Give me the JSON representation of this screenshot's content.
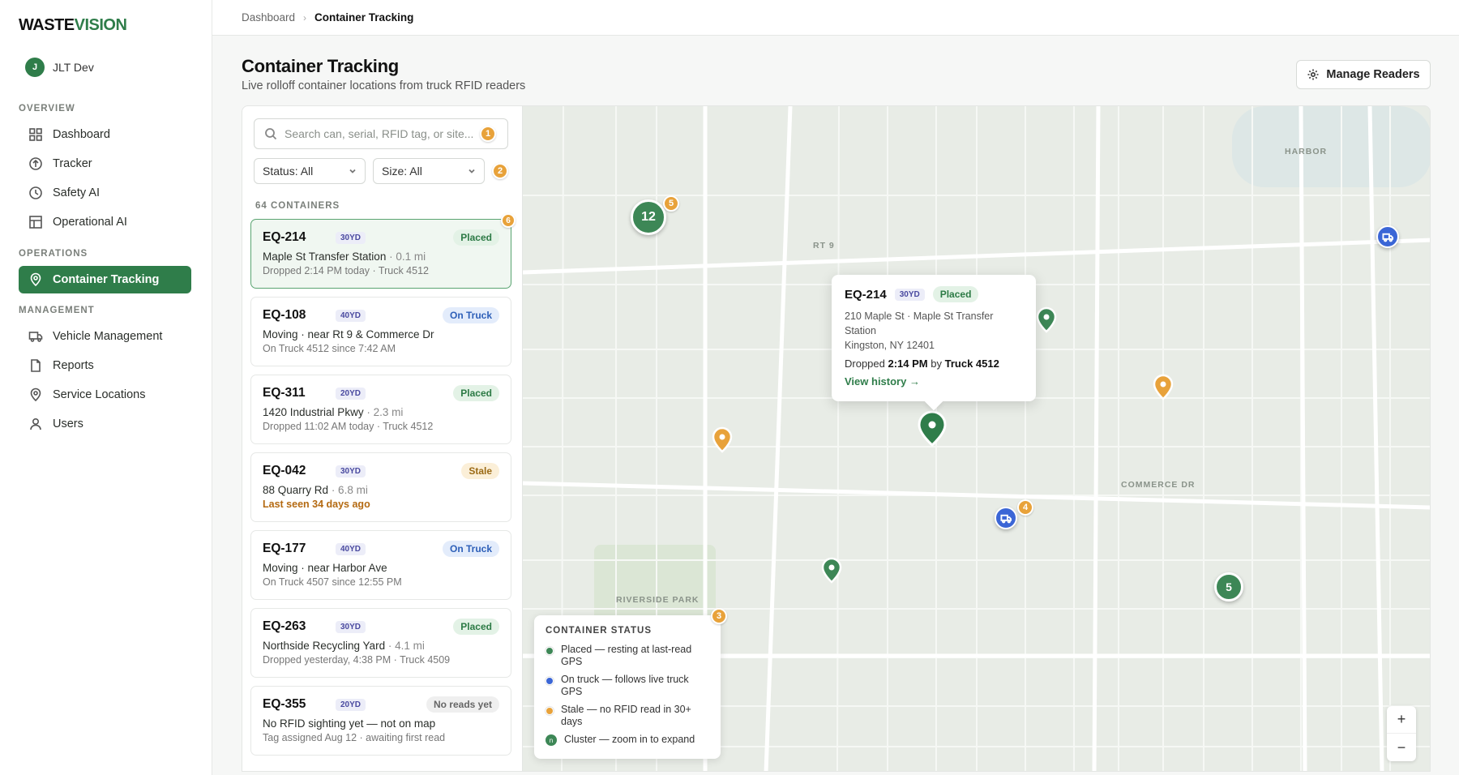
{
  "brand": {
    "part1": "WASTE",
    "part2": "VISION",
    "accent_color": "#2f7d4a"
  },
  "user": {
    "initial": "J",
    "name": "JLT Dev"
  },
  "sidebar": {
    "sections": [
      {
        "label": "OVERVIEW",
        "items": [
          {
            "label": "Dashboard",
            "icon": "grid-icon"
          },
          {
            "label": "Tracker",
            "icon": "arrow-up-circle-icon"
          },
          {
            "label": "Safety AI",
            "icon": "clock-icon"
          },
          {
            "label": "Operational AI",
            "icon": "table-icon"
          }
        ]
      },
      {
        "label": "OPERATIONS",
        "items": [
          {
            "label": "Container Tracking",
            "icon": "map-pin-icon",
            "active": true
          }
        ]
      },
      {
        "label": "MANAGEMENT",
        "items": [
          {
            "label": "Vehicle Management",
            "icon": "truck-icon"
          },
          {
            "label": "Reports",
            "icon": "file-icon"
          },
          {
            "label": "Service Locations",
            "icon": "map-pin-icon"
          },
          {
            "label": "Users",
            "icon": "user-icon"
          }
        ]
      }
    ]
  },
  "breadcrumb": {
    "parent": "Dashboard",
    "separator": "›",
    "current": "Container Tracking"
  },
  "page": {
    "title": "Container Tracking",
    "subtitle": "Live rolloff container locations from truck RFID readers",
    "manage_label": "Manage Readers"
  },
  "filters": {
    "search_placeholder": "Search can, serial, RFID tag, or site...",
    "status": "Status: All",
    "size": "Size: All",
    "count_label": "64 CONTAINERS"
  },
  "step_badges": [
    "1",
    "2",
    "3",
    "4",
    "5",
    "6"
  ],
  "containers": [
    {
      "id": "EQ-214",
      "size": "30YD",
      "status": "Placed",
      "kind": "placed",
      "line2": "Maple St Transfer Station",
      "dist": "· 0.1 mi",
      "line3": "Dropped 2:14 PM today · Truck 4512",
      "selected": true
    },
    {
      "id": "EQ-108",
      "size": "40YD",
      "status": "On Truck",
      "kind": "truck",
      "line2": "Moving · near Rt 9 & Commerce Dr",
      "dist": "",
      "line3": "On Truck 4512 since 7:42 AM"
    },
    {
      "id": "EQ-311",
      "size": "20YD",
      "status": "Placed",
      "kind": "placed",
      "line2": "1420 Industrial Pkwy",
      "dist": "· 2.3 mi",
      "line3": "Dropped 11:02 AM today · Truck 4512"
    },
    {
      "id": "EQ-042",
      "size": "30YD",
      "status": "Stale",
      "kind": "stale",
      "line2": "88 Quarry Rd",
      "dist": "· 6.8 mi",
      "line3": "Last seen 34 days ago",
      "warn": true
    },
    {
      "id": "EQ-177",
      "size": "40YD",
      "status": "On Truck",
      "kind": "truck",
      "line2": "Moving · near Harbor Ave",
      "dist": "",
      "line3": "On Truck 4507 since 12:55 PM"
    },
    {
      "id": "EQ-263",
      "size": "30YD",
      "status": "Placed",
      "kind": "placed",
      "line2": "Northside Recycling Yard",
      "dist": "· 4.1 mi",
      "line3": "Dropped yesterday, 4:38 PM · Truck 4509"
    },
    {
      "id": "EQ-355",
      "size": "20YD",
      "status": "No reads yet",
      "kind": "none",
      "line2": "No RFID sighting yet — not on map",
      "dist": "",
      "line3": "Tag assigned Aug 12 · awaiting first read"
    }
  ],
  "map": {
    "labels": {
      "rt9": "RT 9",
      "harbor": "HARBOR",
      "commerce": "COMMERCE DR",
      "park": "RIVERSIDE PARK"
    },
    "clusters": [
      "12",
      "5"
    ],
    "popup": {
      "id": "EQ-214",
      "size": "30YD",
      "status": "Placed",
      "addr1": "210 Maple St · Maple St Transfer",
      "addr2": "Station",
      "addr3": "Kingston, NY 12401",
      "drop_prefix": "Dropped",
      "drop_time": "2:14 PM",
      "drop_mid": "by",
      "drop_truck": "Truck 4512",
      "link": "View history →"
    },
    "legend": {
      "title": "CONTAINER STATUS",
      "items": [
        {
          "label": "Placed — resting at last-read GPS",
          "color": "#3d8756"
        },
        {
          "label": "On truck — follows live truck GPS",
          "color": "#3b66d6"
        },
        {
          "label": "Stale — no RFID read in 30+ days",
          "color": "#e8a23a"
        },
        {
          "label": "Cluster — zoom in to expand",
          "color": "#3d8756",
          "glyph": "n"
        }
      ]
    },
    "zoom_in": "+",
    "zoom_out": "−"
  }
}
